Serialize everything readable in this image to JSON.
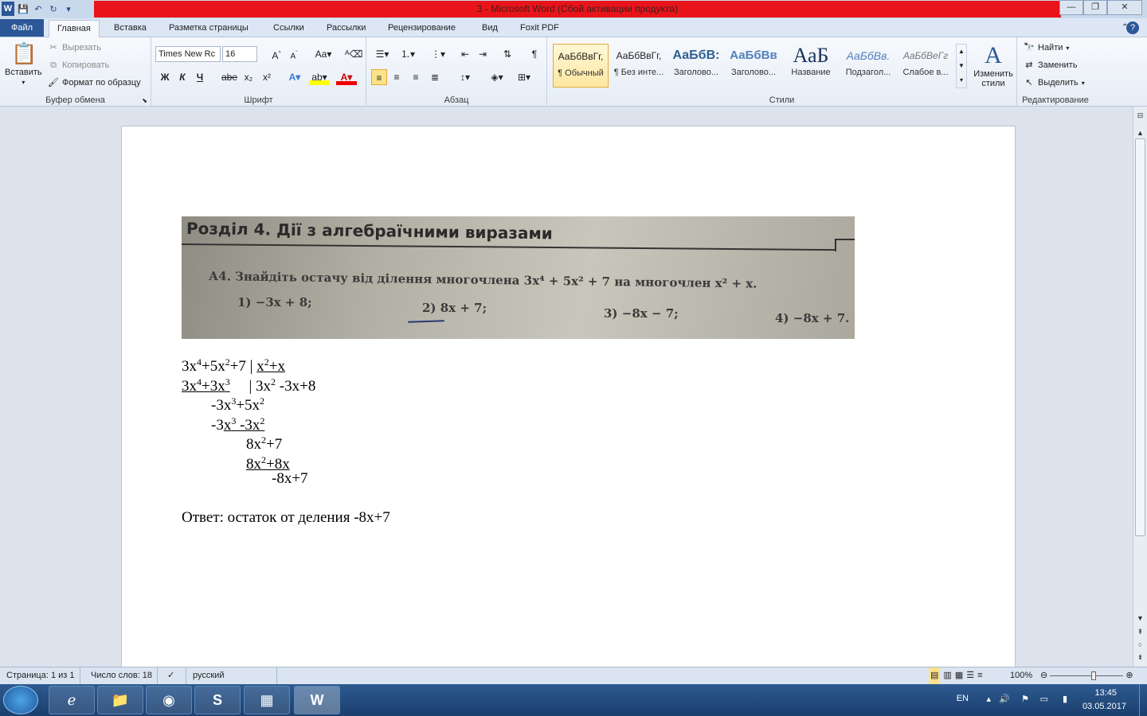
{
  "window": {
    "title": "3 -  Microsoft Word (Сбой активации продукта)",
    "qat": [
      "W",
      "save",
      "undo",
      "redo",
      "more"
    ]
  },
  "tabs": {
    "file": "Файл",
    "items": [
      "Главная",
      "Вставка",
      "Разметка страницы",
      "Ссылки",
      "Рассылки",
      "Рецензирование",
      "Вид",
      "Foxit PDF"
    ]
  },
  "ribbon": {
    "clipboard": {
      "paste": "Вставить",
      "cut": "Вырезать",
      "copy": "Копировать",
      "format_painter": "Формат по образцу",
      "label": "Буфер обмена"
    },
    "font": {
      "name": "Times New Rc",
      "size": "16",
      "label": "Шрифт",
      "bold": "Ж",
      "italic": "К",
      "underline": "Ч",
      "strike": "abe",
      "subscript": "x₂",
      "superscript": "x²"
    },
    "paragraph": {
      "label": "Абзац"
    },
    "styles": {
      "label": "Стили",
      "items": [
        {
          "preview": "АаБбВвГг,",
          "name": "¶ Обычный"
        },
        {
          "preview": "АаБбВвГг,",
          "name": "¶ Без инте..."
        },
        {
          "preview": "АаБбВ:",
          "name": "Заголово..."
        },
        {
          "preview": "АаБбВв",
          "name": "Заголово..."
        },
        {
          "preview": "АаБ",
          "name": "Название"
        },
        {
          "preview": "АаБбВв.",
          "name": "Подзагол..."
        },
        {
          "preview": "АаБбВеГг",
          "name": "Слабое в..."
        }
      ],
      "change_styles": "Изменить стили"
    },
    "editing": {
      "label": "Редактирование",
      "find": "Найти",
      "replace": "Заменить",
      "select": "Выделить"
    }
  },
  "photo": {
    "heading": "Розділ 4. Дії з алгебраїчними виразами",
    "question": "А4. Знайдіть остачу від ділення многочлена 3x⁴ + 5x² + 7 на многочлен x² + x.",
    "options": [
      "1) −3x + 8;",
      "2) 8x + 7;",
      "3) −8x − 7;",
      "4) −8x + 7."
    ]
  },
  "doc": {
    "answer": "Ответ: остаток от деления -8x+7"
  },
  "status": {
    "page": "Страница: 1 из 1",
    "words": "Число слов: 18",
    "lang": "русский",
    "zoom": "100%"
  },
  "tray": {
    "lang": "EN",
    "time": "13:45",
    "date": "03.05.2017"
  }
}
